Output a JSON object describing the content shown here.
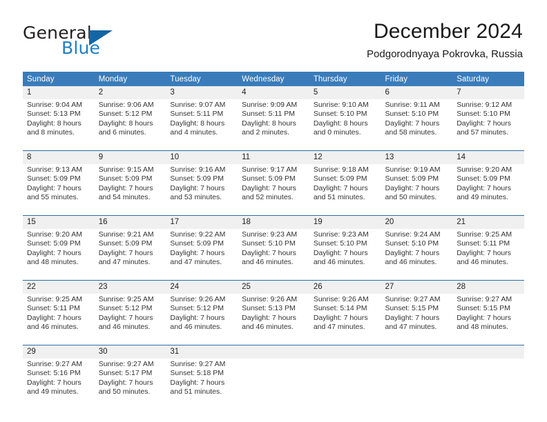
{
  "brand": {
    "name_part1": "General",
    "name_part2": "Blue",
    "accent_color": "#1f7fc4",
    "flag_color": "#1565a4"
  },
  "header": {
    "month_title": "December 2024",
    "location": "Podgorodnyaya Pokrovka, Russia"
  },
  "theme": {
    "header_row_bg": "#3a7cba",
    "week_rule_color": "#2e6da4",
    "date_band_bg": "#f0f0f0"
  },
  "calendar": {
    "weekday_headers": [
      "Sunday",
      "Monday",
      "Tuesday",
      "Wednesday",
      "Thursday",
      "Friday",
      "Saturday"
    ],
    "weeks": [
      {
        "days": [
          {
            "date": "1",
            "sunrise": "Sunrise: 9:04 AM",
            "sunset": "Sunset: 5:13 PM",
            "daylight_line1": "Daylight: 8 hours",
            "daylight_line2": "and 8 minutes."
          },
          {
            "date": "2",
            "sunrise": "Sunrise: 9:06 AM",
            "sunset": "Sunset: 5:12 PM",
            "daylight_line1": "Daylight: 8 hours",
            "daylight_line2": "and 6 minutes."
          },
          {
            "date": "3",
            "sunrise": "Sunrise: 9:07 AM",
            "sunset": "Sunset: 5:11 PM",
            "daylight_line1": "Daylight: 8 hours",
            "daylight_line2": "and 4 minutes."
          },
          {
            "date": "4",
            "sunrise": "Sunrise: 9:09 AM",
            "sunset": "Sunset: 5:11 PM",
            "daylight_line1": "Daylight: 8 hours",
            "daylight_line2": "and 2 minutes."
          },
          {
            "date": "5",
            "sunrise": "Sunrise: 9:10 AM",
            "sunset": "Sunset: 5:10 PM",
            "daylight_line1": "Daylight: 8 hours",
            "daylight_line2": "and 0 minutes."
          },
          {
            "date": "6",
            "sunrise": "Sunrise: 9:11 AM",
            "sunset": "Sunset: 5:10 PM",
            "daylight_line1": "Daylight: 7 hours",
            "daylight_line2": "and 58 minutes."
          },
          {
            "date": "7",
            "sunrise": "Sunrise: 9:12 AM",
            "sunset": "Sunset: 5:10 PM",
            "daylight_line1": "Daylight: 7 hours",
            "daylight_line2": "and 57 minutes."
          }
        ]
      },
      {
        "days": [
          {
            "date": "8",
            "sunrise": "Sunrise: 9:13 AM",
            "sunset": "Sunset: 5:09 PM",
            "daylight_line1": "Daylight: 7 hours",
            "daylight_line2": "and 55 minutes."
          },
          {
            "date": "9",
            "sunrise": "Sunrise: 9:15 AM",
            "sunset": "Sunset: 5:09 PM",
            "daylight_line1": "Daylight: 7 hours",
            "daylight_line2": "and 54 minutes."
          },
          {
            "date": "10",
            "sunrise": "Sunrise: 9:16 AM",
            "sunset": "Sunset: 5:09 PM",
            "daylight_line1": "Daylight: 7 hours",
            "daylight_line2": "and 53 minutes."
          },
          {
            "date": "11",
            "sunrise": "Sunrise: 9:17 AM",
            "sunset": "Sunset: 5:09 PM",
            "daylight_line1": "Daylight: 7 hours",
            "daylight_line2": "and 52 minutes."
          },
          {
            "date": "12",
            "sunrise": "Sunrise: 9:18 AM",
            "sunset": "Sunset: 5:09 PM",
            "daylight_line1": "Daylight: 7 hours",
            "daylight_line2": "and 51 minutes."
          },
          {
            "date": "13",
            "sunrise": "Sunrise: 9:19 AM",
            "sunset": "Sunset: 5:09 PM",
            "daylight_line1": "Daylight: 7 hours",
            "daylight_line2": "and 50 minutes."
          },
          {
            "date": "14",
            "sunrise": "Sunrise: 9:20 AM",
            "sunset": "Sunset: 5:09 PM",
            "daylight_line1": "Daylight: 7 hours",
            "daylight_line2": "and 49 minutes."
          }
        ]
      },
      {
        "days": [
          {
            "date": "15",
            "sunrise": "Sunrise: 9:20 AM",
            "sunset": "Sunset: 5:09 PM",
            "daylight_line1": "Daylight: 7 hours",
            "daylight_line2": "and 48 minutes."
          },
          {
            "date": "16",
            "sunrise": "Sunrise: 9:21 AM",
            "sunset": "Sunset: 5:09 PM",
            "daylight_line1": "Daylight: 7 hours",
            "daylight_line2": "and 47 minutes."
          },
          {
            "date": "17",
            "sunrise": "Sunrise: 9:22 AM",
            "sunset": "Sunset: 5:09 PM",
            "daylight_line1": "Daylight: 7 hours",
            "daylight_line2": "and 47 minutes."
          },
          {
            "date": "18",
            "sunrise": "Sunrise: 9:23 AM",
            "sunset": "Sunset: 5:10 PM",
            "daylight_line1": "Daylight: 7 hours",
            "daylight_line2": "and 46 minutes."
          },
          {
            "date": "19",
            "sunrise": "Sunrise: 9:23 AM",
            "sunset": "Sunset: 5:10 PM",
            "daylight_line1": "Daylight: 7 hours",
            "daylight_line2": "and 46 minutes."
          },
          {
            "date": "20",
            "sunrise": "Sunrise: 9:24 AM",
            "sunset": "Sunset: 5:10 PM",
            "daylight_line1": "Daylight: 7 hours",
            "daylight_line2": "and 46 minutes."
          },
          {
            "date": "21",
            "sunrise": "Sunrise: 9:25 AM",
            "sunset": "Sunset: 5:11 PM",
            "daylight_line1": "Daylight: 7 hours",
            "daylight_line2": "and 46 minutes."
          }
        ]
      },
      {
        "days": [
          {
            "date": "22",
            "sunrise": "Sunrise: 9:25 AM",
            "sunset": "Sunset: 5:11 PM",
            "daylight_line1": "Daylight: 7 hours",
            "daylight_line2": "and 46 minutes."
          },
          {
            "date": "23",
            "sunrise": "Sunrise: 9:25 AM",
            "sunset": "Sunset: 5:12 PM",
            "daylight_line1": "Daylight: 7 hours",
            "daylight_line2": "and 46 minutes."
          },
          {
            "date": "24",
            "sunrise": "Sunrise: 9:26 AM",
            "sunset": "Sunset: 5:12 PM",
            "daylight_line1": "Daylight: 7 hours",
            "daylight_line2": "and 46 minutes."
          },
          {
            "date": "25",
            "sunrise": "Sunrise: 9:26 AM",
            "sunset": "Sunset: 5:13 PM",
            "daylight_line1": "Daylight: 7 hours",
            "daylight_line2": "and 46 minutes."
          },
          {
            "date": "26",
            "sunrise": "Sunrise: 9:26 AM",
            "sunset": "Sunset: 5:14 PM",
            "daylight_line1": "Daylight: 7 hours",
            "daylight_line2": "and 47 minutes."
          },
          {
            "date": "27",
            "sunrise": "Sunrise: 9:27 AM",
            "sunset": "Sunset: 5:15 PM",
            "daylight_line1": "Daylight: 7 hours",
            "daylight_line2": "and 47 minutes."
          },
          {
            "date": "28",
            "sunrise": "Sunrise: 9:27 AM",
            "sunset": "Sunset: 5:15 PM",
            "daylight_line1": "Daylight: 7 hours",
            "daylight_line2": "and 48 minutes."
          }
        ]
      },
      {
        "days": [
          {
            "date": "29",
            "sunrise": "Sunrise: 9:27 AM",
            "sunset": "Sunset: 5:16 PM",
            "daylight_line1": "Daylight: 7 hours",
            "daylight_line2": "and 49 minutes."
          },
          {
            "date": "30",
            "sunrise": "Sunrise: 9:27 AM",
            "sunset": "Sunset: 5:17 PM",
            "daylight_line1": "Daylight: 7 hours",
            "daylight_line2": "and 50 minutes."
          },
          {
            "date": "31",
            "sunrise": "Sunrise: 9:27 AM",
            "sunset": "Sunset: 5:18 PM",
            "daylight_line1": "Daylight: 7 hours",
            "daylight_line2": "and 51 minutes."
          },
          {
            "date": "",
            "sunrise": "",
            "sunset": "",
            "daylight_line1": "",
            "daylight_line2": ""
          },
          {
            "date": "",
            "sunrise": "",
            "sunset": "",
            "daylight_line1": "",
            "daylight_line2": ""
          },
          {
            "date": "",
            "sunrise": "",
            "sunset": "",
            "daylight_line1": "",
            "daylight_line2": ""
          },
          {
            "date": "",
            "sunrise": "",
            "sunset": "",
            "daylight_line1": "",
            "daylight_line2": ""
          }
        ]
      }
    ]
  }
}
